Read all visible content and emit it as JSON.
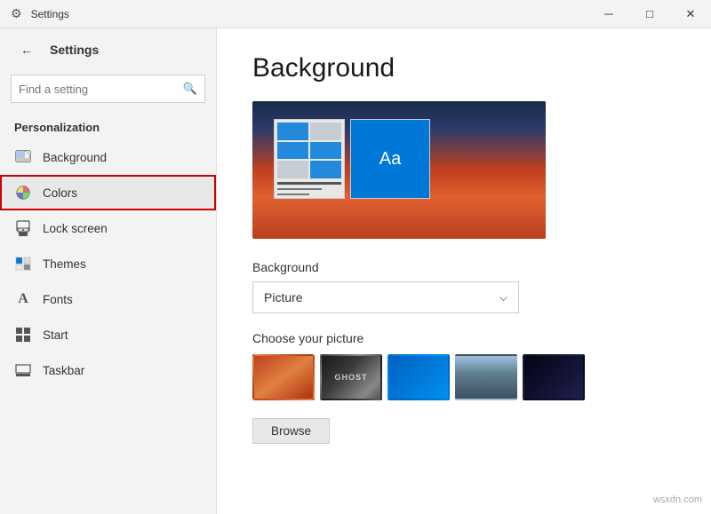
{
  "titleBar": {
    "title": "Settings",
    "minimize": "─",
    "maximize": "□",
    "close": "✕"
  },
  "sidebar": {
    "backLabel": "←",
    "appTitle": "Settings",
    "search": {
      "placeholder": "Find a setting",
      "icon": "🔍"
    },
    "sectionLabel": "Personalization",
    "items": [
      {
        "id": "background",
        "label": "Background",
        "icon": "🖼"
      },
      {
        "id": "colors",
        "label": "Colors",
        "icon": "🎨"
      },
      {
        "id": "lock-screen",
        "label": "Lock screen",
        "icon": "🖥"
      },
      {
        "id": "themes",
        "label": "Themes",
        "icon": "🎭"
      },
      {
        "id": "fonts",
        "label": "Fonts",
        "icon": "A"
      },
      {
        "id": "start",
        "label": "Start",
        "icon": "⊞"
      },
      {
        "id": "taskbar",
        "label": "Taskbar",
        "icon": "▬"
      }
    ]
  },
  "content": {
    "pageTitle": "Background",
    "backgroundLabel": "Background",
    "dropdownValue": "Picture",
    "dropdownArrow": "⌵",
    "choosePictureLabel": "Choose your picture",
    "browseLabel": "Browse"
  }
}
